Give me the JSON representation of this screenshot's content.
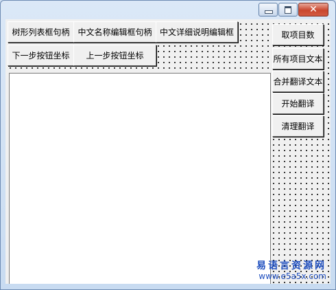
{
  "titlebar": {
    "minimize_icon": "minimize-icon",
    "maximize_icon": "maximize-icon",
    "close_icon": "close-icon",
    "close_glyph": "✕"
  },
  "buttons": {
    "tree_handle": "树形列表框句柄",
    "cn_name_handle": "中文名称编辑框句柄",
    "cn_detail_edit": "中文详细说明编辑框",
    "next_step": "下一步按钮坐标",
    "prev_step": "上一步按钮坐标",
    "get_count": "取项目数",
    "all_text": "所有项目文本",
    "merge_translate": "合并翻译文本",
    "start_translate": "开始翻译",
    "clear_translate": "清理翻译"
  },
  "watermark": {
    "name": "易语言资源网",
    "url": "www.e5a5x.com"
  },
  "colors": {
    "window_frame": "#6d8bb3",
    "client_bg": "#f0f0f0",
    "close_button": "#c9472f",
    "watermark": "#1f4fbf"
  }
}
